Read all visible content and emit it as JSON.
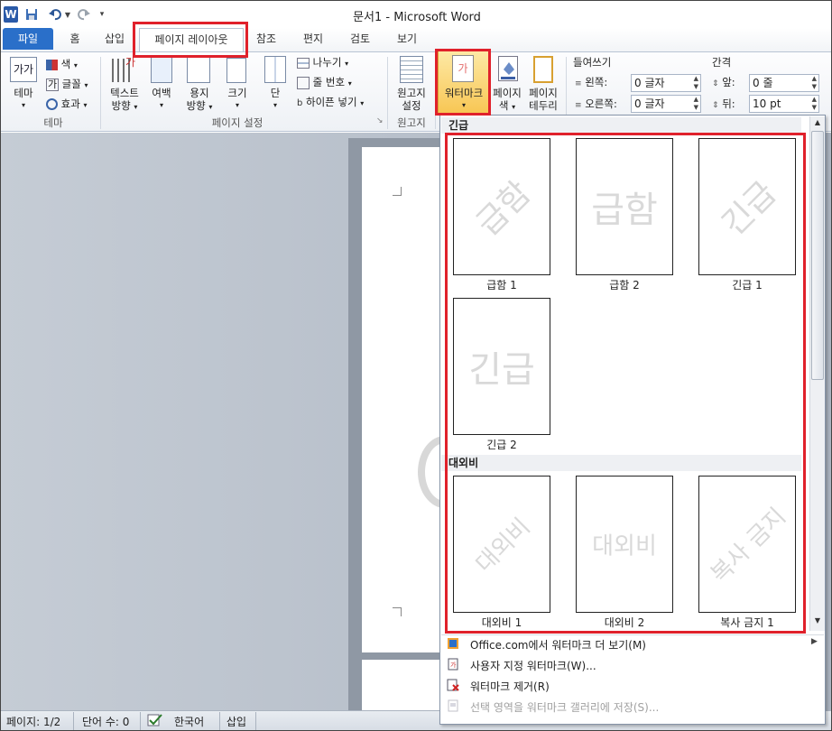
{
  "window": {
    "title": "문서1 - Microsoft Word"
  },
  "quick_access": {
    "app_icon": "W",
    "save_icon": "save-icon",
    "undo_icon": "undo-icon",
    "redo_icon": "redo-icon",
    "customize": "customize-icon"
  },
  "tabs": [
    "파일",
    "홈",
    "삽입",
    "페이지 레이아웃",
    "참조",
    "편지",
    "검토",
    "보기"
  ],
  "ribbon": {
    "theme": {
      "theme_label": "테마",
      "colors": "색",
      "fonts": "글꼴",
      "effects": "효과",
      "group": "테마",
      "icon_text": "가가",
      "fonts_icon": "가"
    },
    "page_setup": {
      "text_direction": [
        "텍스트",
        "방향"
      ],
      "margins": "여백",
      "orientation": [
        "용지",
        "방향"
      ],
      "size": "크기",
      "columns": "단",
      "breaks": "나누기",
      "line_numbers": "줄 번호",
      "hyphenation": "하이픈 넣기",
      "group": "페이지 설정"
    },
    "manuscript": {
      "label": [
        "원고지",
        "설정"
      ],
      "group": "원고지"
    },
    "background": {
      "watermark": "워터마크",
      "page_color": [
        "페이지",
        "색"
      ],
      "page_borders": [
        "페이지",
        "테두리"
      ]
    },
    "indent": {
      "title": "들여쓰기",
      "left_label": "왼쪽:",
      "left_value": "0 글자",
      "right_label": "오른쪽:",
      "right_value": "0 글자"
    },
    "spacing": {
      "title": "간격",
      "before_label": "앞:",
      "before_value": "0 줄",
      "after_label": "뒤:",
      "after_value": "10 pt"
    }
  },
  "gallery": {
    "sections": [
      {
        "title": "긴급",
        "items": [
          {
            "caption": "급함 1",
            "watermark": "급함",
            "style": "diagonal"
          },
          {
            "caption": "급함 2",
            "watermark": "급함",
            "style": "horizontal"
          },
          {
            "caption": "긴급 1",
            "watermark": "긴급",
            "style": "diagonal"
          },
          {
            "caption": "긴급 2",
            "watermark": "긴급",
            "style": "horizontal"
          }
        ]
      },
      {
        "title": "대외비",
        "items": [
          {
            "caption": "대외비 1",
            "watermark": "대외비",
            "style": "diagonal"
          },
          {
            "caption": "대외비 2",
            "watermark": "대외비",
            "style": "horizontal"
          },
          {
            "caption": "복사 금지 1",
            "watermark": "복사 금지",
            "style": "diagonal"
          }
        ]
      }
    ],
    "menu": [
      {
        "label": "Office.com에서 워터마크 더 보기(M)",
        "icon": "office-icon",
        "has_arrow": true,
        "disabled": false
      },
      {
        "label": "사용자 지정 워터마크(W)...",
        "icon": "custom-watermark-icon",
        "disabled": false
      },
      {
        "label": "워터마크 제거(R)",
        "icon": "remove-watermark-icon",
        "disabled": false
      },
      {
        "label": "선택 영역을 워터마크 갤러리에 저장(S)...",
        "icon": "save-selection-icon",
        "disabled": true
      }
    ]
  },
  "statusbar": {
    "page": "페이지: 1/2",
    "words": "단어 수: 0",
    "language": "한국어",
    "mode": "삽입"
  },
  "colors": {
    "highlight": "#e0212b",
    "file_tab": "#2a6fc9",
    "watermark_text": "#d9d9d9"
  }
}
